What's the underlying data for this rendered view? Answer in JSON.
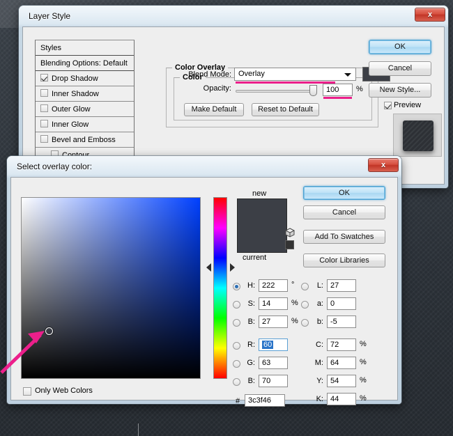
{
  "desktop": {
    "background_color": "#30363d"
  },
  "layer_style": {
    "title": "Layer Style",
    "close_label": "x",
    "styles_header": "Styles",
    "styles": [
      {
        "label": "Styles",
        "checkbox": false,
        "checked": false,
        "indent": false
      },
      {
        "label": "Blending Options: Default",
        "checkbox": false,
        "checked": false,
        "indent": false
      },
      {
        "label": "Drop Shadow",
        "checkbox": true,
        "checked": true,
        "indent": false
      },
      {
        "label": "Inner Shadow",
        "checkbox": true,
        "checked": false,
        "indent": false
      },
      {
        "label": "Outer Glow",
        "checkbox": true,
        "checked": false,
        "indent": false
      },
      {
        "label": "Inner Glow",
        "checkbox": true,
        "checked": false,
        "indent": false
      },
      {
        "label": "Bevel and Emboss",
        "checkbox": true,
        "checked": false,
        "indent": false
      },
      {
        "label": "Contour",
        "checkbox": true,
        "checked": false,
        "indent": true
      }
    ],
    "color_overlay_group": "Color Overlay",
    "color_group": "Color",
    "blend_mode_label": "Blend Mode:",
    "blend_mode_value": "Overlay",
    "blend_color_swatch": "#3c3f46",
    "opacity_label": "Opacity:",
    "opacity_value": "100",
    "opacity_unit": "%",
    "make_default": "Make Default",
    "reset_to_default": "Reset to Default",
    "ok": "OK",
    "cancel": "Cancel",
    "new_style": "New Style...",
    "preview_label": "Preview",
    "preview_checked": true,
    "highlight_color": "#ec1f8b"
  },
  "color_picker": {
    "title": "Select overlay color:",
    "close_label": "x",
    "new_label": "new",
    "current_label": "current",
    "new_color": "#3c3f46",
    "current_color": "#3c3f46",
    "gamut_icon": "cube-icon",
    "websafe_color": "#333333",
    "buttons": {
      "ok": "OK",
      "cancel": "Cancel",
      "add_to_swatches": "Add To Swatches",
      "color_libraries": "Color Libraries"
    },
    "hsb": [
      {
        "key": "H:",
        "value": "222",
        "unit": "°",
        "selected_radio": true
      },
      {
        "key": "S:",
        "value": "14",
        "unit": "%",
        "selected_radio": false
      },
      {
        "key": "B:",
        "value": "27",
        "unit": "%",
        "selected_radio": false
      }
    ],
    "rgb": [
      {
        "key": "R:",
        "value": "60",
        "unit": "",
        "selected_radio": false,
        "focused": true
      },
      {
        "key": "G:",
        "value": "63",
        "unit": "",
        "selected_radio": false,
        "focused": false
      },
      {
        "key": "B:",
        "value": "70",
        "unit": "",
        "selected_radio": false,
        "focused": false
      }
    ],
    "lab": [
      {
        "key": "L:",
        "value": "27",
        "unit": "",
        "selected_radio": false
      },
      {
        "key": "a:",
        "value": "0",
        "unit": "",
        "selected_radio": false
      },
      {
        "key": "b:",
        "value": "-5",
        "unit": "",
        "selected_radio": false
      }
    ],
    "cmyk": [
      {
        "key": "C:",
        "value": "72",
        "unit": "%"
      },
      {
        "key": "M:",
        "value": "64",
        "unit": "%"
      },
      {
        "key": "Y:",
        "value": "54",
        "unit": "%"
      },
      {
        "key": "K:",
        "value": "44",
        "unit": "%"
      }
    ],
    "hex_symbol": "#",
    "hex_value": "3c3f46",
    "only_web_colors_label": "Only Web Colors",
    "only_web_colors_checked": false,
    "hue_degrees": 222,
    "annotation_arrow_color": "#ec1f8b"
  }
}
